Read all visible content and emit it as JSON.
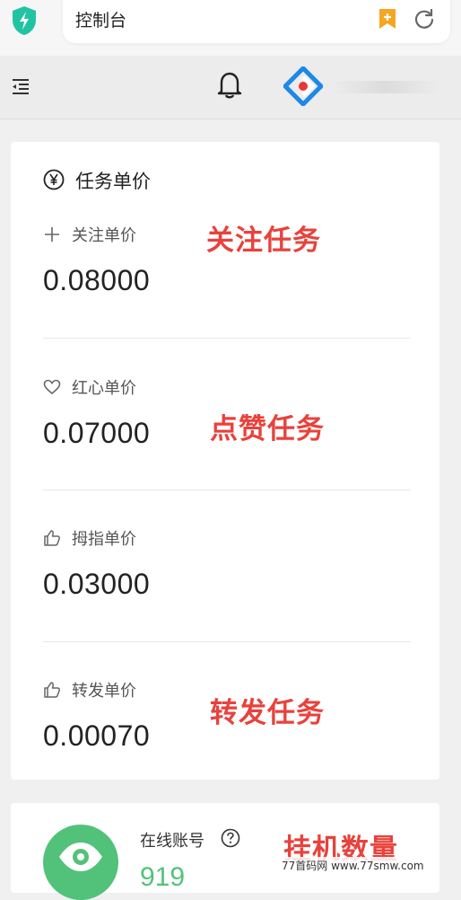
{
  "browser": {
    "address_text": "控制台",
    "icons": [
      "shield-icon",
      "bookmark-icon",
      "refresh-icon"
    ]
  },
  "header": {
    "icons": [
      "menu-fold-icon",
      "bell-icon",
      "app-logo-icon"
    ]
  },
  "task_prices": {
    "title": "任务单价",
    "items": [
      {
        "icon": "plus-icon",
        "label": "关注单价",
        "value": "0.08000",
        "annotation": "关注任务"
      },
      {
        "icon": "heart-icon",
        "label": "红心单价",
        "value": "0.07000",
        "annotation": "点赞任务"
      },
      {
        "icon": "thumb-up-icon",
        "label": "拇指单价",
        "value": "0.03000",
        "annotation": ""
      },
      {
        "icon": "thumb-up-icon",
        "label": "转发单价",
        "value": "0.00070",
        "annotation": "转发任务"
      }
    ]
  },
  "online": {
    "label": "在线账号",
    "count": "919",
    "annotation": "挂机数量"
  },
  "watermark": "77首码网 www.77smw.com",
  "colors": {
    "annotation_red": "#e8423c",
    "accent_green": "#52c27a",
    "logo_blue": "#1e88e5",
    "logo_red": "#e53935",
    "bookmark_orange": "#f5a623",
    "shield_teal": "#22c3a4"
  }
}
